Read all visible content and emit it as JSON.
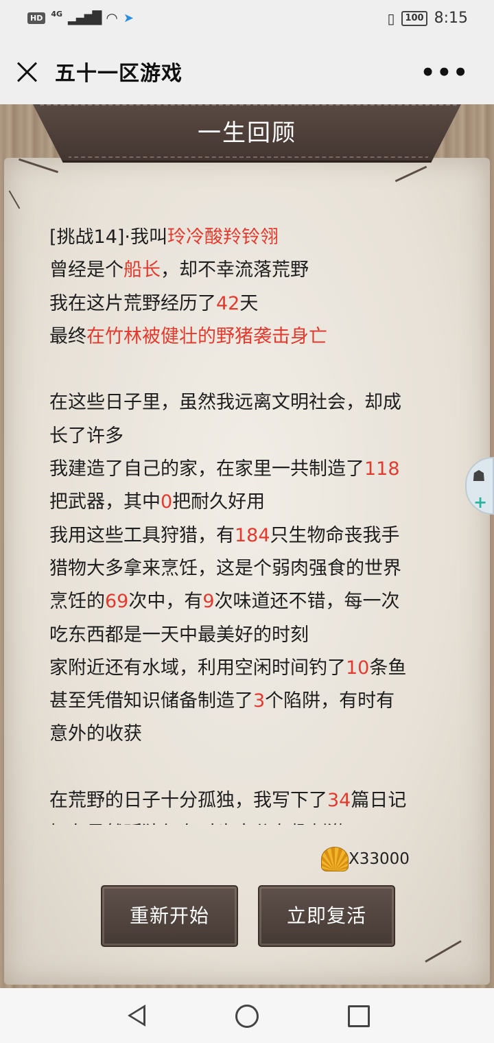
{
  "status_bar": {
    "hd": "HD",
    "network": "4G",
    "time": "8:15",
    "battery": "100"
  },
  "nav": {
    "title": "五十一区游戏",
    "more": "•••"
  },
  "game": {
    "banner_title": "一生回顾",
    "story": {
      "l0_a": "[挑战14]·我叫",
      "l0_b": "玲冷酸羚铃翎",
      "l1_a": "曾经是个",
      "l1_b": "船长",
      "l1_c": "，却不幸流落荒野",
      "l2_a": "我在这片荒野经历了",
      "l2_b": "42",
      "l2_c": "天",
      "l3_a": "最终",
      "l3_b": "在竹林被健壮的野猪袭击身亡",
      "l5": "在这些日子里，虽然我远离文明社会，却成",
      "l6": "长了许多",
      "l7_a": "我建造了自己的家，在家里一共制造了",
      "l7_b": "118",
      "l8_a": "把武器，其中",
      "l8_b": "0",
      "l8_c": "把耐久好用",
      "l9_a": "我用这些工具狩猎，有",
      "l9_b": "184",
      "l9_c": "只生物命丧我手",
      "l10": "猎物大多拿来烹饪，这是个弱肉强食的世界",
      "l11_a": "烹饪的",
      "l11_b": "69",
      "l11_c": "次中，有",
      "l11_d": "9",
      "l11_e": "次味道还不错，每一次",
      "l12": "吃东西都是一天中最美好的时刻",
      "l13_a": "家附近还有水域，利用空闲时间钓了",
      "l13_b": "10",
      "l13_c": "条鱼",
      "l14_a": "甚至凭借知识储备制造了",
      "l14_b": "3",
      "l14_c": "个陷阱，有时有",
      "l15": "意外的收获",
      "l17_a": "在荒野的日子十分孤独，我写下了",
      "l17_b": "34",
      "l17_c": "篇日记",
      "l18": "好在虽然孤独但有时也十分有趣刺激"
    },
    "currency": "X33000",
    "btn_restart": "重新开始",
    "btn_revive": "立即复活"
  },
  "colors": {
    "highlight": "#e23a2e",
    "button": "#4f423d",
    "banner": "#4d3f3a"
  }
}
